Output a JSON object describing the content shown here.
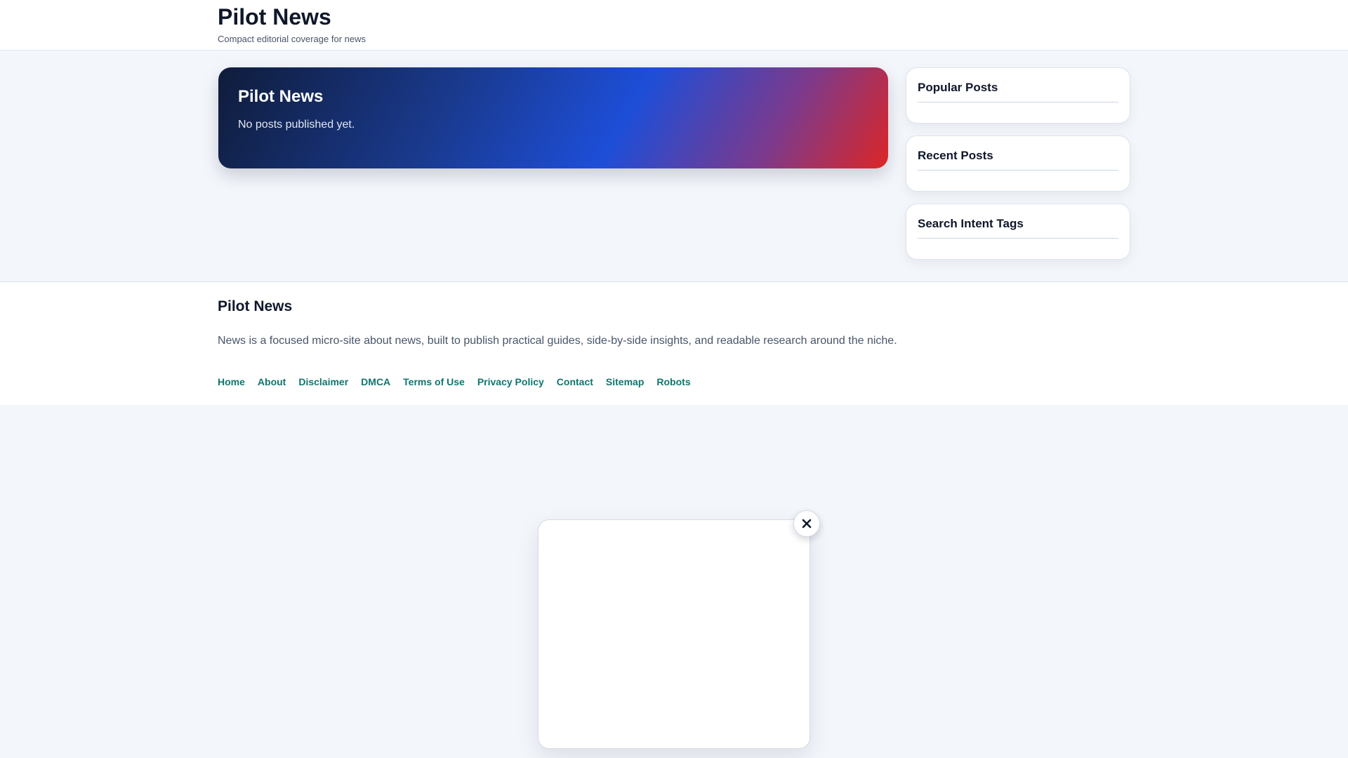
{
  "header": {
    "site_title": "Pilot News",
    "tagline": "Compact editorial coverage for news"
  },
  "hero": {
    "title": "Pilot News",
    "message": "No posts published yet."
  },
  "sidebar": {
    "widgets": [
      {
        "title": "Popular Posts"
      },
      {
        "title": "Recent Posts"
      },
      {
        "title": "Search Intent Tags"
      }
    ]
  },
  "footer": {
    "title": "Pilot News",
    "description": "News is a focused micro-site about news, built to publish practical guides, side-by-side insights, and readable research around the niche.",
    "links": [
      {
        "label": "Home"
      },
      {
        "label": "About"
      },
      {
        "label": "Disclaimer"
      },
      {
        "label": "DMCA"
      },
      {
        "label": "Terms of Use"
      },
      {
        "label": "Privacy Policy"
      },
      {
        "label": "Contact"
      },
      {
        "label": "Sitemap"
      },
      {
        "label": "Robots"
      }
    ]
  },
  "popup": {
    "close_icon": "close-icon"
  },
  "colors": {
    "link": "#0f766e",
    "hero_start": "#0f1c3a",
    "hero_mid": "#1d4ed8",
    "hero_end": "#dc2626"
  }
}
